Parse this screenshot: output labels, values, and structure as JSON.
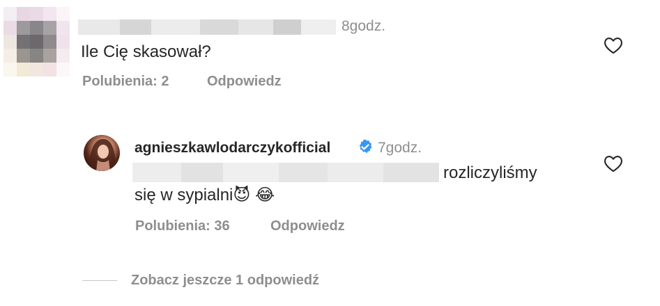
{
  "comment1": {
    "time": "8godz.",
    "text": "Ile Cię skasował?",
    "likes_label": "Polubienia: 2",
    "reply_label": "Odpowiedz"
  },
  "reply1": {
    "username": "agnieszkawlodarczykofficial",
    "time": "7godz.",
    "text_line1": "rozliczyliśmy",
    "text_line2": "się w sypialni",
    "emoji1": "😈",
    "emoji2": "😂",
    "likes_label": "Polubienia: 36",
    "reply_label": "Odpowiedz"
  },
  "view_more_label": "Zobacz jeszcze 1 odpowiedź",
  "icons": {
    "heart": "heart-icon",
    "verified": "verified-badge-icon"
  },
  "colors": {
    "text": "#262626",
    "secondary": "#8e8e8e",
    "verified_blue": "#3897f0"
  }
}
